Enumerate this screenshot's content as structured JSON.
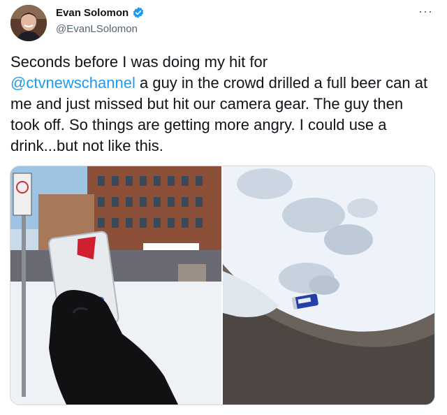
{
  "author": {
    "display_name": "Evan Solomon",
    "handle": "@EvanLSolomon",
    "verified": true
  },
  "tweet": {
    "text_before_mention": "Seconds before I was doing my hit for",
    "mention": "@ctvnewschannel",
    "text_after_mention": " a guy in the crowd drilled a full beer can at me and just missed but hit our camera gear. The guy then took off. So things are getting more angry. I could use a drink...but not like this."
  },
  "media": {
    "photo_left": "beer-can-in-gloved-hand-photo",
    "photo_right": "beer-can-in-snow-photo"
  },
  "icons": {
    "verified": "verified-badge-icon",
    "more": "more-options-icon"
  },
  "colors": {
    "accent": "#1d9bf0",
    "text": "#0f1419",
    "secondary": "#536471"
  }
}
